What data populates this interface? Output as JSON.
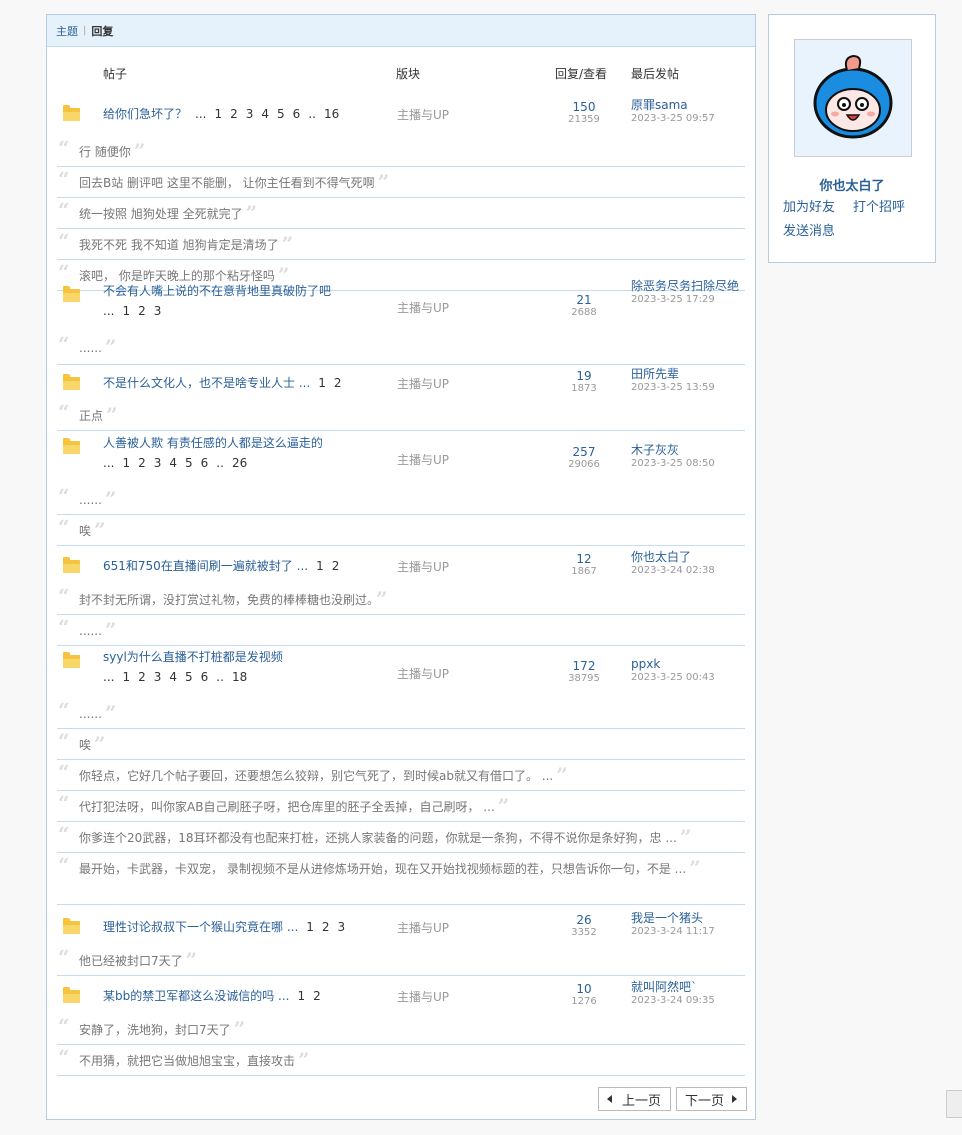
{
  "tabs": {
    "topics": "主题",
    "replies": "回复"
  },
  "columns": {
    "post": "帖子",
    "forum": "版块",
    "reply_view": "回复/查看",
    "last_post": "最后发帖"
  },
  "threads": [
    {
      "title": "给你们急坏了？",
      "pages": [
        "...",
        "1",
        "2",
        "3",
        "4",
        "5",
        "6",
        "..",
        "16"
      ],
      "forum": "主播与UP",
      "replies": "150",
      "views": "21359",
      "last_user": "原罪sama",
      "last_time": "2023-3-25 09:57",
      "quotes": [
        "行 随便你",
        "回去B站 删评吧 这里不能删， 让你主任看到不得气死啊",
        "统一按照 旭狗处理 全死就完了",
        "我死不死 我不知道 旭狗肯定是清场了",
        "滚吧， 你是昨天晚上的那个粘牙怪吗"
      ]
    },
    {
      "title": "不会有人嘴上说的不在意背地里真破防了吧",
      "pages": [
        "...",
        "1",
        "2",
        "3"
      ],
      "forum": "主播与UP",
      "replies": "21",
      "views": "2688",
      "last_user": "除恶务尽务扫除尽绝",
      "last_time": "2023-3-25 17:29",
      "quotes": [
        "......"
      ]
    },
    {
      "title": "不是什么文化人，也不是啥专业人士 ...",
      "pages": [
        "1",
        "2"
      ],
      "forum": "主播与UP",
      "replies": "19",
      "views": "1873",
      "last_user": "田所先辈",
      "last_time": "2023-3-25 13:59",
      "quotes": [
        "正点"
      ]
    },
    {
      "title": "人善被人欺 有责任感的人都是这么逼走的",
      "pages": [
        "...",
        "1",
        "2",
        "3",
        "4",
        "5",
        "6",
        "..",
        "26"
      ],
      "forum": "主播与UP",
      "replies": "257",
      "views": "29066",
      "last_user": "木子灰灰",
      "last_time": "2023-3-25 08:50",
      "quotes": [
        "......",
        "唉"
      ]
    },
    {
      "title": "651和750在直播间刷一遍就被封了 ...",
      "pages": [
        "1",
        "2"
      ],
      "forum": "主播与UP",
      "replies": "12",
      "views": "1867",
      "last_user": "你也太白了",
      "last_time": "2023-3-24 02:38",
      "quotes": [
        "封不封无所谓，没打赏过礼物，免费的棒棒糖也没刷过。",
        "......"
      ]
    },
    {
      "title": "syyl为什么直播不打桩都是发视频",
      "pages": [
        "...",
        "1",
        "2",
        "3",
        "4",
        "5",
        "6",
        "..",
        "18"
      ],
      "forum": "主播与UP",
      "replies": "172",
      "views": "38795",
      "last_user": "ppxk",
      "last_time": "2023-3-25 00:43",
      "quotes": [
        "......",
        "唉",
        "你轻点，它好几个帖子要回，还要想怎么狡辩，别它气死了，到时候ab就又有借口了。 ...",
        "代打犯法呀，叫你家AB自己刷胚子呀，把仓库里的胚子全丢掉，自己刷呀， ...",
        "你爹连个20武器，18耳环都没有也配来打桩，还挑人家装备的问题，你就是一条狗，不得不说你是条好狗，忠 ...",
        "最开始，卡武器，卡双宠， 录制视频不是从进修炼场开始，现在又开始找视频标题的茬，只想告诉你一句，不是 ..."
      ]
    },
    {
      "title": "理性讨论叔叔下一个猴山究竟在哪 ...",
      "pages": [
        "1",
        "2",
        "3"
      ],
      "forum": "主播与UP",
      "replies": "26",
      "views": "3352",
      "last_user": "我是一个猪头",
      "last_time": "2023-3-24 11:17",
      "quotes": [
        "他已经被封口7天了"
      ]
    },
    {
      "title": "某bb的禁卫军都这么没诚信的吗 ...",
      "pages": [
        "1",
        "2"
      ],
      "forum": "主播与UP",
      "replies": "10",
      "views": "1276",
      "last_user": "就叫阿然吧`",
      "last_time": "2023-3-24 09:35",
      "quotes": [
        "安静了，洗地狗，封口7天了",
        "不用猜，就把它当做旭旭宝宝，直接攻击"
      ]
    }
  ],
  "pager": {
    "prev": "上一页",
    "next": "下一页"
  },
  "profile": {
    "name": "你也太白了",
    "add_friend": "加为好友",
    "greet": "打个招呼",
    "message": "发送消息"
  }
}
